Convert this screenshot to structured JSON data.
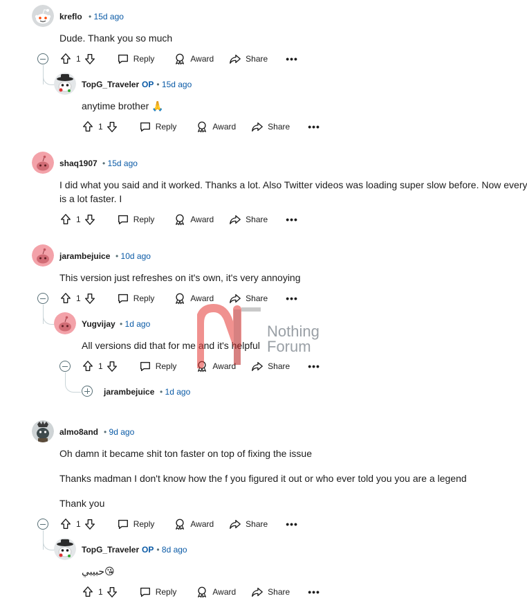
{
  "actions": {
    "reply": "Reply",
    "award": "Award",
    "share": "Share",
    "more": "•••"
  },
  "watermark": {
    "line1": "Nothing",
    "line2": "Forum"
  },
  "comments": [
    {
      "user": "kreflo",
      "time": "15d ago",
      "votes": "1",
      "lines": [
        "Dude. Thank you so much"
      ]
    },
    {
      "user": "TopG_Traveler",
      "op": "OP",
      "time": "15d ago",
      "votes": "1",
      "lines": [
        "anytime brother 🙏"
      ]
    },
    {
      "user": "shaq1907",
      "time": "15d ago",
      "votes": "1",
      "lines": [
        "I did what you said and it worked. Thanks a lot. Also Twitter videos was loading super slow before. Now everyt",
        "is a lot faster. I"
      ]
    },
    {
      "user": "jarambejuice",
      "time": "10d ago",
      "votes": "1",
      "lines": [
        "This version just refreshes on it's own, it's very annoying"
      ]
    },
    {
      "user": "Yugvijay",
      "time": "1d ago",
      "votes": "1",
      "lines": [
        "All versions did that for me and it's helpful"
      ]
    },
    {
      "user": "jarambejuice",
      "time": "1d ago"
    },
    {
      "user": "almo8and",
      "time": "9d ago",
      "votes": "1",
      "lines": [
        "Oh damn it became shit ton faster on top of fixing the issue",
        "Thanks madman I don't know how the f you figured it out or who ever told you you are a legend",
        "Thank you"
      ]
    },
    {
      "user": "TopG_Traveler",
      "op": "OP",
      "time": "8d ago",
      "votes": "1",
      "lines": [
        "حبيبي😘"
      ]
    }
  ]
}
